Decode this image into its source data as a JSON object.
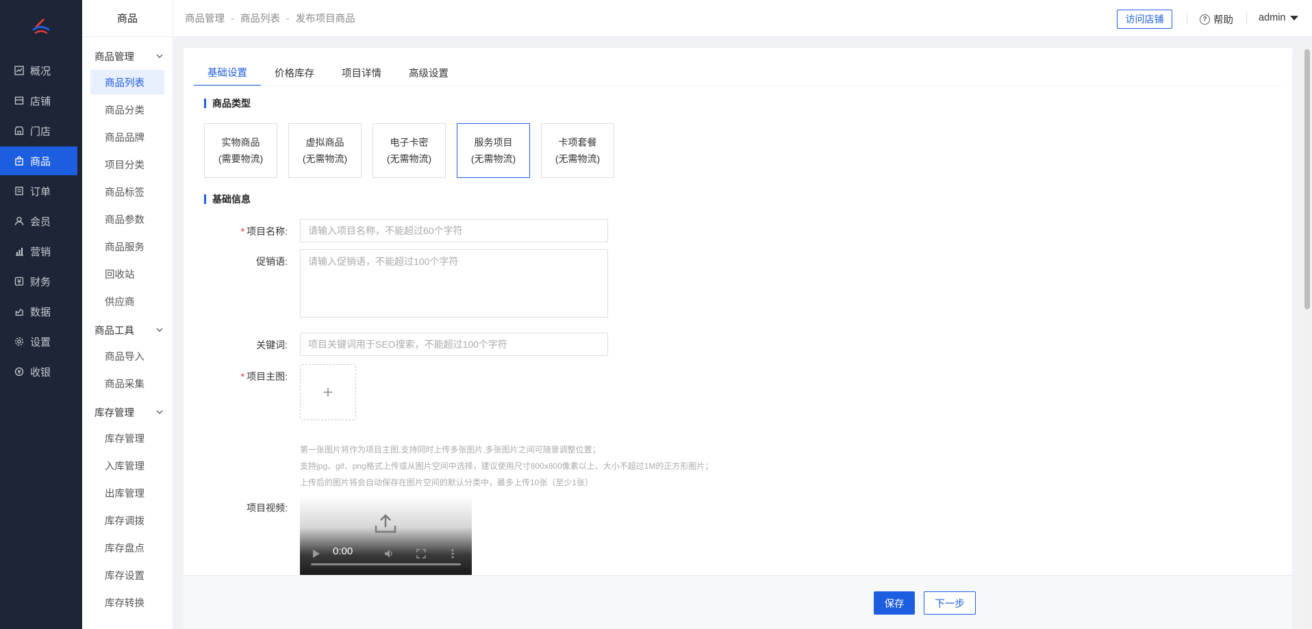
{
  "nav": {
    "items": [
      {
        "label": "概况",
        "icon": "chart-line-icon"
      },
      {
        "label": "店铺",
        "icon": "shop-icon"
      },
      {
        "label": "门店",
        "icon": "store-icon"
      },
      {
        "label": "商品",
        "icon": "bag-icon",
        "active": true
      },
      {
        "label": "订单",
        "icon": "order-icon"
      },
      {
        "label": "会员",
        "icon": "user-icon"
      },
      {
        "label": "营销",
        "icon": "bar-chart-icon"
      },
      {
        "label": "财务",
        "icon": "finance-icon"
      },
      {
        "label": "数据",
        "icon": "data-icon"
      },
      {
        "label": "设置",
        "icon": "gear-icon"
      },
      {
        "label": "收银",
        "icon": "cashier-icon"
      }
    ]
  },
  "subnav": {
    "title": "商品",
    "groups": [
      {
        "label": "商品管理",
        "items": [
          "商品列表",
          "商品分类",
          "商品品牌",
          "项目分类",
          "商品标签",
          "商品参数",
          "商品服务",
          "回收站",
          "供应商"
        ]
      },
      {
        "label": "商品工具",
        "items": [
          "商品导入",
          "商品采集"
        ]
      },
      {
        "label": "库存管理",
        "items": [
          "库存管理",
          "入库管理",
          "出库管理",
          "库存调拨",
          "库存盘点",
          "库存设置",
          "库存转换"
        ]
      }
    ]
  },
  "header": {
    "breadcrumb": [
      "商品管理",
      "商品列表",
      "发布项目商品"
    ],
    "breadcrumb_sep": "-",
    "visit_store": "访问店铺",
    "help": "帮助",
    "user": "admin"
  },
  "tabs": [
    "基础设置",
    "价格库存",
    "项目详情",
    "高级设置"
  ],
  "sections": {
    "type_title": "商品类型",
    "basic_title": "基础信息"
  },
  "types": [
    {
      "name": "实物商品",
      "desc": "(需要物流)"
    },
    {
      "name": "虚拟商品",
      "desc": "(无需物流)"
    },
    {
      "name": "电子卡密",
      "desc": "(无需物流)"
    },
    {
      "name": "服务项目",
      "desc": "(无需物流)",
      "active": true
    },
    {
      "name": "卡项套餐",
      "desc": "(无需物流)"
    }
  ],
  "form": {
    "name_label": "项目名称:",
    "name_placeholder": "请输入项目名称，不能超过60个字符",
    "promo_label": "促销语:",
    "promo_placeholder": "请输入促销语，不能超过100个字符",
    "keyword_label": "关键词:",
    "keyword_placeholder": "项目关键词用于SEO搜索，不能超过100个字符",
    "image_label": "项目主图:",
    "upload_plus": "+",
    "hints": [
      "第一张图片将作为项目主图,支持同时上传多张图片,多张图片之间可随意调整位置；",
      "支持jpg、gif、png格式上传或从图片空间中选择，建议使用尺寸800x800像素以上、大小不超过1M的正方形图片；",
      "上传后的图片将会自动保存在图片空间的默认分类中，最多上传10张（至少1张）"
    ],
    "video_label": "项目视频:",
    "video_time": "0:00"
  },
  "actions": {
    "save": "保存",
    "next": "下一步"
  },
  "colors": {
    "accent": "#1d5ee0",
    "nav_bg": "#1e2536",
    "required": "#f5222d"
  }
}
